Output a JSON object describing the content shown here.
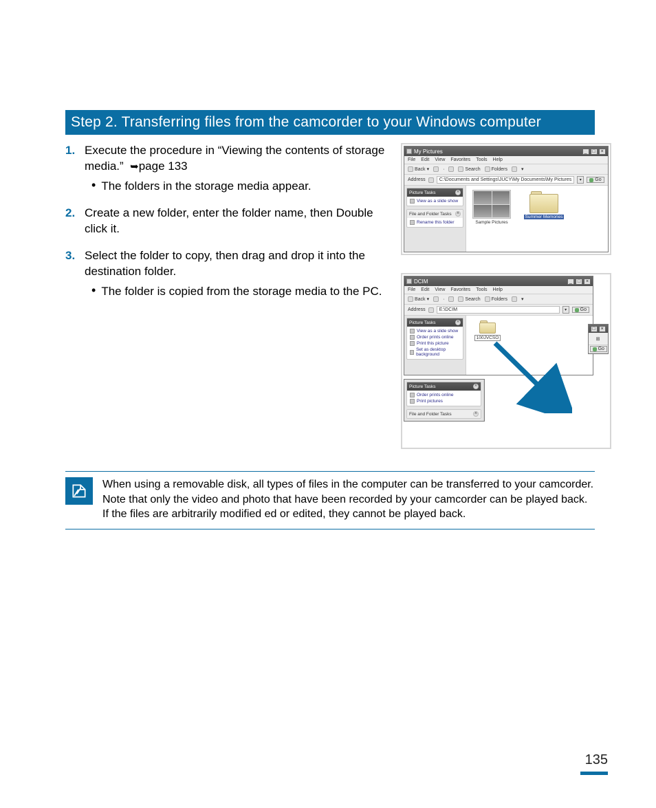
{
  "banner": "Step 2. Transferring files from the camcorder to your Windows computer",
  "steps": [
    {
      "num": "1.",
      "text": "Execute the procedure in “Viewing the contents of storage media.”  ",
      "page_ref": "page 133",
      "bullets": [
        "The folders in the storage media appear."
      ]
    },
    {
      "num": "2.",
      "text": "Create a new folder, enter the folder name, then Double click it.",
      "bullets": []
    },
    {
      "num": "3.",
      "text": "Select the folder to copy, then drag and drop it into the destination folder.",
      "bullets": [
        "The folder is copied from the storage media to the PC."
      ]
    }
  ],
  "note": "When using a removable disk, all types of files in the computer can be transferred to your camcorder. Note that only the video and photo that have been recorded by your camcorder can be played back. If the files are arbitrarily modified ed or edited, they cannot be played back.",
  "page_number": "135",
  "shot1": {
    "title": "My Pictures",
    "menus": [
      "File",
      "Edit",
      "View",
      "Favorites",
      "Tools",
      "Help"
    ],
    "toolbar": {
      "back": "Back",
      "search": "Search",
      "folders": "Folders"
    },
    "address_label": "Address",
    "address": "C:\\Documents and Settings\\JUCY\\My Documents\\My Pictures",
    "go": "Go",
    "panels": {
      "picture_tasks": {
        "title": "Picture Tasks",
        "items": [
          "View as a slide show"
        ]
      },
      "file_tasks": {
        "title": "File and Folder Tasks",
        "items": [
          "Rename this folder"
        ]
      }
    },
    "items": [
      {
        "label": "Sample Pictures"
      },
      {
        "label": "Summer Memories"
      }
    ]
  },
  "shot2": {
    "winA": {
      "title": "DCIM",
      "menus": [
        "File",
        "Edit",
        "View",
        "Favorites",
        "Tools",
        "Help"
      ],
      "toolbar": {
        "back": "Back",
        "search": "Search",
        "folders": "Folders"
      },
      "address_label": "Address",
      "address": "E:\\DCIM",
      "go": "Go",
      "panel": {
        "title": "Picture Tasks",
        "items": [
          "View as a slide show",
          "Order prints online",
          "Print this picture",
          "Set as desktop background"
        ]
      },
      "folder": "100JVCSO"
    },
    "winB": {
      "panel": {
        "title": "Picture Tasks",
        "items": [
          "Order prints online",
          "Print pictures"
        ]
      },
      "panel2": {
        "title": "File and Folder Tasks"
      }
    },
    "winC": {
      "go": "Go"
    }
  }
}
